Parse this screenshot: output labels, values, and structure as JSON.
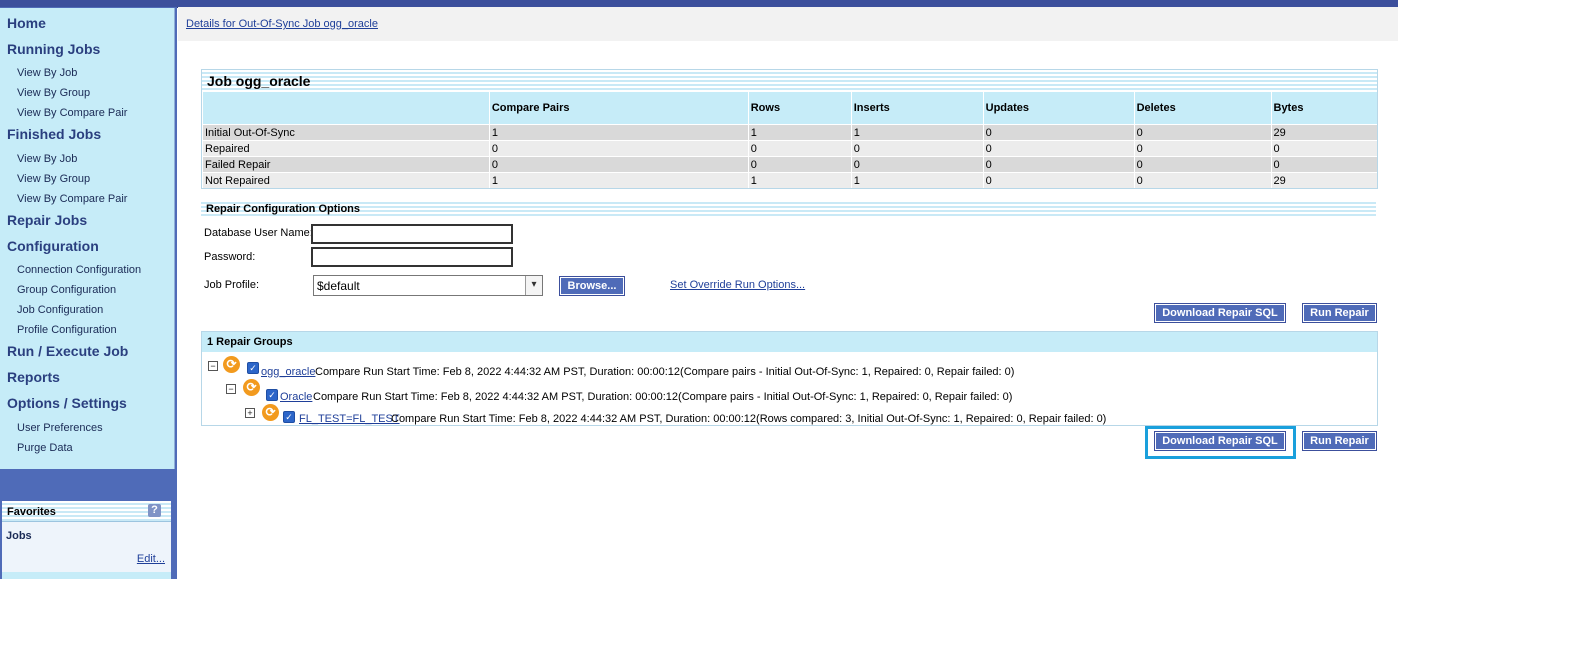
{
  "sidebar": {
    "categories": {
      "home": "Home",
      "running_jobs": "Running Jobs",
      "finished_jobs": "Finished Jobs",
      "repair_jobs": "Repair Jobs",
      "configuration": "Configuration",
      "run_execute_job": "Run / Execute Job",
      "reports": "Reports",
      "options_settings": "Options / Settings"
    },
    "running_items": [
      "View By Job",
      "View By Group",
      "View By Compare Pair"
    ],
    "finished_items": [
      "View By Job",
      "View By Group",
      "View By Compare Pair"
    ],
    "configuration_items": [
      "Connection Configuration",
      "Group Configuration",
      "Job Configuration",
      "Profile Configuration"
    ],
    "options_items": [
      "User Preferences",
      "Purge Data"
    ],
    "favorites": {
      "title": "Favorites",
      "help": "?",
      "jobs": "Jobs",
      "edit": "Edit..."
    }
  },
  "breadcrumb": "Details for Out-Of-Sync Job ogg_oracle",
  "job": {
    "title": "Job ogg_oracle",
    "columns": [
      "",
      "Compare Pairs",
      "Rows",
      "Inserts",
      "Updates",
      "Deletes",
      "Bytes"
    ],
    "rows": [
      [
        "Initial Out-Of-Sync",
        "1",
        "1",
        "1",
        "0",
        "0",
        "29"
      ],
      [
        "Repaired",
        "0",
        "0",
        "0",
        "0",
        "0",
        "0"
      ],
      [
        "Failed Repair",
        "0",
        "0",
        "0",
        "0",
        "0",
        "0"
      ],
      [
        "Not Repaired",
        "1",
        "1",
        "1",
        "0",
        "0",
        "29"
      ]
    ]
  },
  "repair_options": {
    "title": "Repair Configuration Options",
    "db_user_label": "Database User Name:",
    "db_user_value": "",
    "password_label": "Password:",
    "password_value": "",
    "profile_label": "Job Profile:",
    "profile_value": "$default",
    "browse_label": "Browse...",
    "override_link": "Set Override Run Options..."
  },
  "actions": {
    "download_sql": "Download Repair SQL",
    "run_repair": "Run Repair"
  },
  "groups": {
    "title": "1 Repair Groups",
    "tree": [
      {
        "toggle": "−",
        "link": "ogg_oracle",
        "text": "Compare Run Start Time: Feb 8, 2022 4:44:32 AM PST, Duration: 00:00:12(Compare pairs - Initial Out-Of-Sync: 1, Repaired: 0, Repair failed: 0)"
      },
      {
        "toggle": "−",
        "link": "Oracle",
        "text": "Compare Run Start Time: Feb 8, 2022 4:44:32 AM PST, Duration: 00:00:12(Compare pairs - Initial Out-Of-Sync: 1, Repaired: 0, Repair failed: 0)"
      },
      {
        "toggle": "+",
        "link": "FL_TEST=FL_TEST",
        "text": "Compare Run Start Time: Feb 8, 2022 4:44:32 AM PST, Duration: 00:00:12(Rows compared: 3, Initial Out-Of-Sync: 1, Repaired: 0, Repair failed: 0)"
      }
    ]
  },
  "icons": {
    "sync": "sync-icon",
    "checkbox": "checkbox-checked-icon",
    "dropdown": "chevron-down-icon"
  },
  "colors": {
    "nav_bg": "#c6ecf8",
    "sidebar_frame": "#4f6bb8",
    "button": "#4f6bb8",
    "link": "#1f3f99",
    "highlight": "#1aa0dc",
    "sync_icon": "#f29a1e"
  }
}
